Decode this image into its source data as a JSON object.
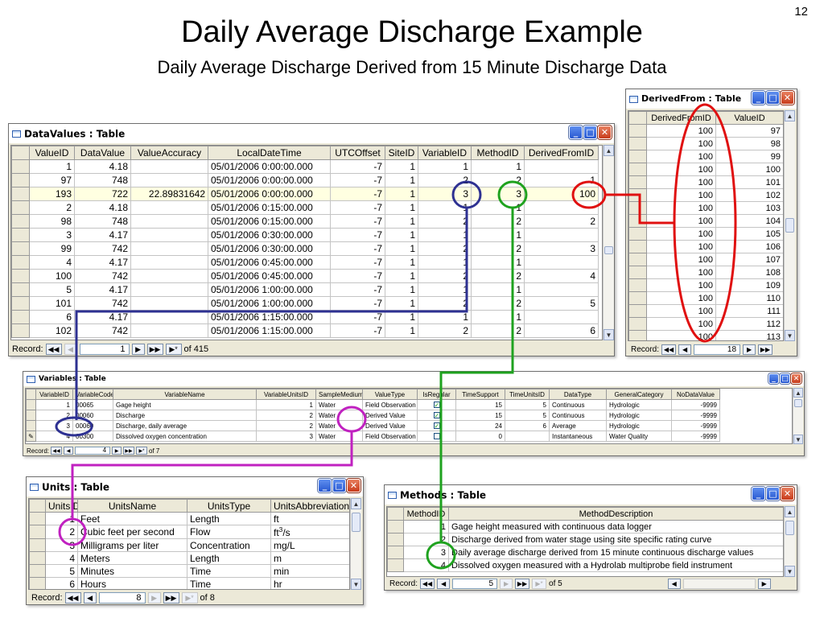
{
  "slide": {
    "number": "12",
    "title": "Daily Average Discharge Example",
    "subtitle": "Daily Average Discharge Derived from 15 Minute Discharge Data"
  },
  "datavalues": {
    "title": "DataValues : Table",
    "columns": [
      "ValueID",
      "DataValue",
      "ValueAccuracy",
      "LocalDateTime",
      "UTCOffset",
      "SiteID",
      "VariableID",
      "MethodID",
      "DerivedFromID"
    ],
    "rows": [
      [
        "1",
        "4.18",
        "",
        "05/01/2006 0:00:00.000",
        "-7",
        "1",
        "1",
        "1",
        ""
      ],
      [
        "97",
        "748",
        "",
        "05/01/2006 0:00:00.000",
        "-7",
        "1",
        "2",
        "2",
        "1"
      ],
      [
        "193",
        "722",
        "22.89831642",
        "05/01/2006 0:00:00.000",
        "-7",
        "1",
        "3",
        "3",
        "100"
      ],
      [
        "2",
        "4.18",
        "",
        "05/01/2006 0:15:00.000",
        "-7",
        "1",
        "1",
        "1",
        ""
      ],
      [
        "98",
        "748",
        "",
        "05/01/2006 0:15:00.000",
        "-7",
        "1",
        "2",
        "2",
        "2"
      ],
      [
        "3",
        "4.17",
        "",
        "05/01/2006 0:30:00.000",
        "-7",
        "1",
        "1",
        "1",
        ""
      ],
      [
        "99",
        "742",
        "",
        "05/01/2006 0:30:00.000",
        "-7",
        "1",
        "2",
        "2",
        "3"
      ],
      [
        "4",
        "4.17",
        "",
        "05/01/2006 0:45:00.000",
        "-7",
        "1",
        "1",
        "1",
        ""
      ],
      [
        "100",
        "742",
        "",
        "05/01/2006 0:45:00.000",
        "-7",
        "1",
        "2",
        "2",
        "4"
      ],
      [
        "5",
        "4.17",
        "",
        "05/01/2006 1:00:00.000",
        "-7",
        "1",
        "1",
        "1",
        ""
      ],
      [
        "101",
        "742",
        "",
        "05/01/2006 1:00:00.000",
        "-7",
        "1",
        "2",
        "2",
        "5"
      ],
      [
        "6",
        "4.17",
        "",
        "05/01/2006 1:15:00.000",
        "-7",
        "1",
        "1",
        "1",
        ""
      ],
      [
        "102",
        "742",
        "",
        "05/01/2006 1:15:00.000",
        "-7",
        "1",
        "2",
        "2",
        "6"
      ]
    ],
    "highlighted_row": 2,
    "nav": {
      "label": "Record:",
      "current": "1",
      "of": "of  415"
    }
  },
  "derivedfrom": {
    "title": "DerivedFrom : Table",
    "columns": [
      "DerivedFromID",
      "ValueID"
    ],
    "rows": [
      [
        "100",
        "97"
      ],
      [
        "100",
        "98"
      ],
      [
        "100",
        "99"
      ],
      [
        "100",
        "100"
      ],
      [
        "100",
        "101"
      ],
      [
        "100",
        "102"
      ],
      [
        "100",
        "103"
      ],
      [
        "100",
        "104"
      ],
      [
        "100",
        "105"
      ],
      [
        "100",
        "106"
      ],
      [
        "100",
        "107"
      ],
      [
        "100",
        "108"
      ],
      [
        "100",
        "109"
      ],
      [
        "100",
        "110"
      ],
      [
        "100",
        "111"
      ],
      [
        "100",
        "112"
      ],
      [
        "100",
        "113"
      ]
    ],
    "nav": {
      "label": "Record:",
      "current": "18"
    }
  },
  "variables": {
    "title": "Variables : Table",
    "columns": [
      "VariableID",
      "VariableCode",
      "VariableName",
      "VariableUnitsID",
      "SampleMedium",
      "ValueType",
      "IsRegular",
      "TimeSupport",
      "TimeUnitsID",
      "DataType",
      "GeneralCategory",
      "NoDataValue"
    ],
    "rows": [
      [
        "1",
        "00065",
        "Gage height",
        "1",
        "Water",
        "Field Observation",
        "yes",
        "15",
        "5",
        "Continuous",
        "Hydrologic",
        "-9999"
      ],
      [
        "2",
        "00060",
        "Discharge",
        "2",
        "Water",
        "Derived Value",
        "yes",
        "15",
        "5",
        "Continuous",
        "Hydrologic",
        "-9999"
      ],
      [
        "3",
        "00060",
        "Discharge, daily average",
        "2",
        "Water",
        "Derived Value",
        "yes",
        "24",
        "6",
        "Average",
        "Hydrologic",
        "-9999"
      ],
      [
        "4",
        "00300",
        "Dissolved oxygen concentration",
        "3",
        "Water",
        "Field Observation",
        "no",
        "0",
        "",
        "Instantaneous",
        "Water Quality",
        "-9999"
      ]
    ],
    "nav": {
      "label": "Record:",
      "current": "4",
      "of": "of  7"
    }
  },
  "units": {
    "title": "Units : Table",
    "columns": [
      "UnitsID",
      "UnitsName",
      "UnitsType",
      "UnitsAbbreviation"
    ],
    "rows": [
      [
        "1",
        "Feet",
        "Length",
        "ft"
      ],
      [
        "2",
        "Cubic feet per second",
        "Flow",
        "ft^3/s"
      ],
      [
        "3",
        "Milligrams per liter",
        "Concentration",
        "mg/L"
      ],
      [
        "4",
        "Meters",
        "Length",
        "m"
      ],
      [
        "5",
        "Minutes",
        "Time",
        "min"
      ],
      [
        "6",
        "Hours",
        "Time",
        "hr"
      ]
    ],
    "nav": {
      "label": "Record:",
      "current": "8",
      "of": "of  8"
    }
  },
  "methods": {
    "title": "Methods : Table",
    "columns": [
      "MethodID",
      "MethodDescription"
    ],
    "rows": [
      [
        "1",
        "Gage height measured with continuous data logger"
      ],
      [
        "2",
        "Discharge derived from water stage using site specific rating curve"
      ],
      [
        "3",
        "Daily average discharge derived from 15 minute continuous discharge values"
      ],
      [
        "4",
        "Dissolved oxygen measured with a Hydrolab multiprobe field instrument"
      ]
    ],
    "nav": {
      "label": "Record:",
      "current": "5",
      "of": "of  5"
    }
  },
  "colors": {
    "navy": "#2e3192",
    "green": "#1fa21f",
    "red": "#e01010",
    "magenta": "#c021c0",
    "highlight_row": "#ffffe1"
  }
}
